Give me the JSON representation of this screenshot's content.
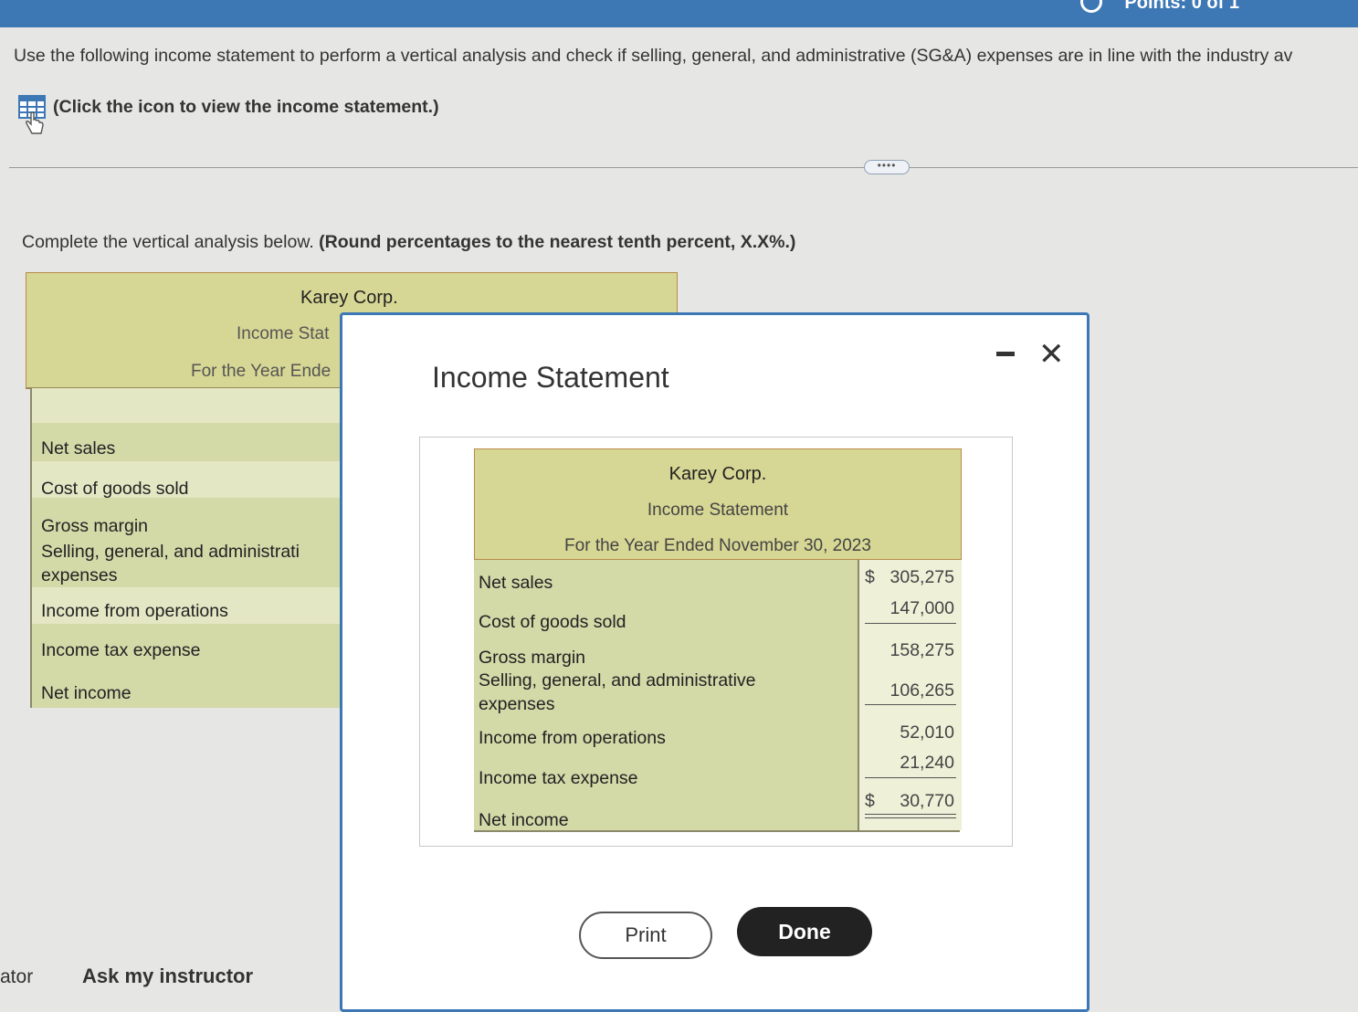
{
  "topbar": {
    "status": "Points: 0 of 1"
  },
  "instruction": "Use the following income statement to perform a vertical analysis and check if selling, general, and administrative (SG&A) expenses are in line with the industry av",
  "statement_link": "(Click the icon to view the income statement.)",
  "more_button": "••••",
  "complete_text": "Complete the vertical analysis below.",
  "complete_hint": "(Round percentages to the nearest tenth percent, X.X%.)",
  "analysis": {
    "company": "Karey Corp.",
    "statement": "Income Stat",
    "period": "For the Year Ende",
    "rows": [
      "Net sales",
      "Cost of goods sold",
      "Gross margin",
      "Selling, general, and administrati",
      "expenses",
      "Income from operations",
      "Income tax expense",
      "Net income"
    ]
  },
  "modal": {
    "title": "Income Statement",
    "company": "Karey Corp.",
    "statement": "Income Statement",
    "period": "For the Year Ended November 30, 2023",
    "rows": [
      {
        "label": "Net sales",
        "currency": "$",
        "value": "305,275"
      },
      {
        "label": "Cost of goods sold",
        "currency": "",
        "value": "147,000"
      },
      {
        "label": "Gross margin",
        "currency": "",
        "value": "158,275"
      },
      {
        "label": "Selling, general, and administrative",
        "label2": "expenses",
        "currency": "",
        "value": "106,265"
      },
      {
        "label": "Income from operations",
        "currency": "",
        "value": "52,010"
      },
      {
        "label": "Income tax expense",
        "currency": "",
        "value": "21,240"
      },
      {
        "label": "Net income",
        "currency": "$",
        "value": "30,770"
      }
    ],
    "print_label": "Print",
    "done_label": "Done"
  },
  "footer": {
    "left_label": "ator",
    "ask_label": "Ask my instructor"
  }
}
